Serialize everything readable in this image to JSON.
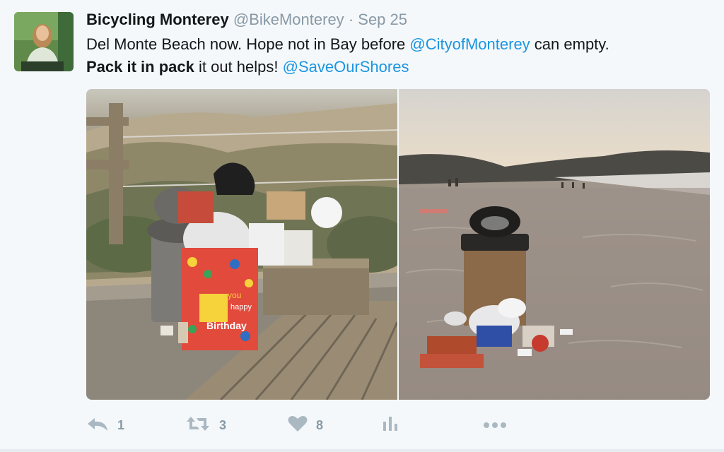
{
  "tweet": {
    "name": "Bicycling Monterey",
    "handle": "@BikeMonterey",
    "separator": "·",
    "date": "Sep 25",
    "line1_text": "Del Monte Beach now. Hope not in Bay before ",
    "line1_mention": "@CityofMonterey",
    "line1_end": " can empty.",
    "line2_bold": "Pack it in pack",
    "line2_text": " it out helps! ",
    "line2_mention": "@SaveOurShores"
  },
  "media": {
    "bag_text_1": "you",
    "bag_text_2": "happy",
    "bag_text_3": "Birthday"
  },
  "actions": {
    "reply_count": "1",
    "retweet_count": "3",
    "like_count": "8"
  },
  "colors": {
    "accent": "#1b95e0",
    "muted": "#8899a6",
    "icon": "#aab8c2"
  }
}
